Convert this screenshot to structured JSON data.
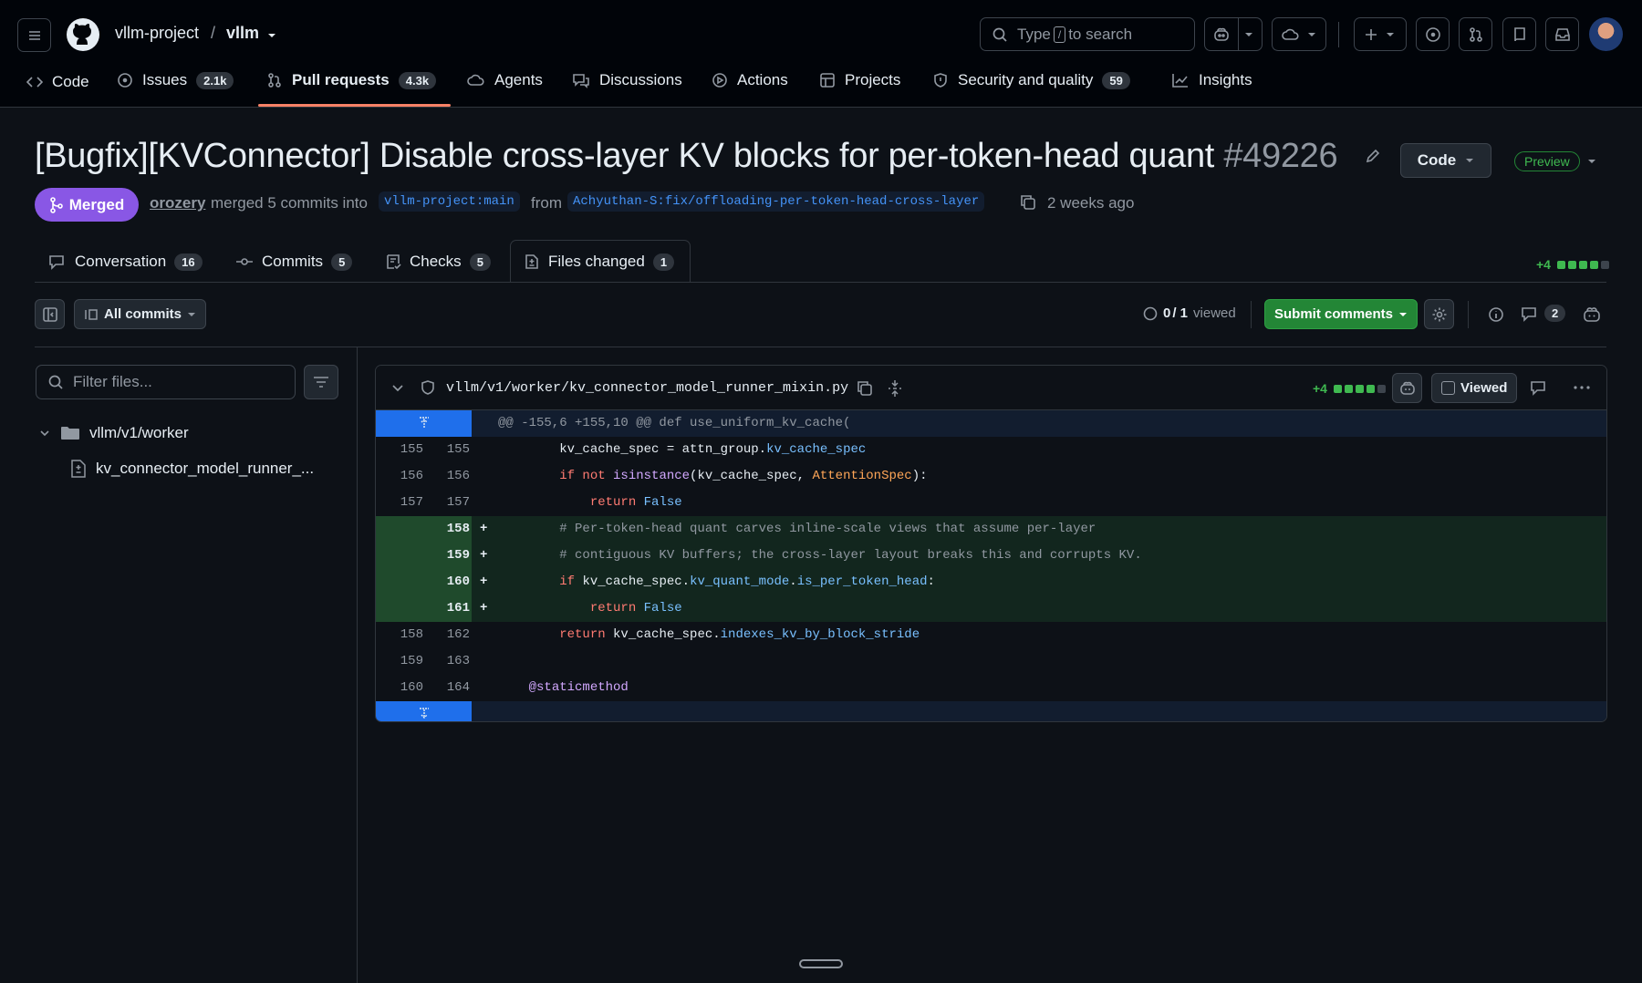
{
  "repo": {
    "owner": "vllm-project",
    "separator": "/",
    "name": "vllm"
  },
  "search": {
    "prefix": "Type",
    "key": "/",
    "suffix": "to search"
  },
  "nav": [
    {
      "label": "Code",
      "icon": "code-icon"
    },
    {
      "label": "Issues",
      "count": "2.1k",
      "icon": "issue-icon"
    },
    {
      "label": "Pull requests",
      "count": "4.3k",
      "icon": "pull-request-icon"
    },
    {
      "label": "Agents",
      "icon": "agents-icon"
    },
    {
      "label": "Discussions",
      "icon": "discussion-icon"
    },
    {
      "label": "Actions",
      "icon": "play-icon"
    },
    {
      "label": "Projects",
      "icon": "table-icon"
    },
    {
      "label": "Security and quality",
      "count": "59",
      "icon": "shield-icon"
    },
    {
      "label": "Insights",
      "icon": "graph-icon"
    }
  ],
  "pr": {
    "title": "[Bugfix][KVConnector] Disable cross-layer KV blocks for per-token-head quant",
    "number": "#49226",
    "code_button": "Code",
    "preview_badge": "Preview",
    "state": "Merged",
    "author": "orozery",
    "merged_text": "merged 5 commits into",
    "base_branch": "vllm-project:main",
    "from_text": "from",
    "head_branch": "Achyuthan-S:fix/offloading-per-token-head-cross-layer",
    "time": "2 weeks ago"
  },
  "tabs": [
    {
      "label": "Conversation",
      "count": "16"
    },
    {
      "label": "Commits",
      "count": "5"
    },
    {
      "label": "Checks",
      "count": "5"
    },
    {
      "label": "Files changed",
      "count": "1"
    }
  ],
  "diffstat": {
    "additions": "+4",
    "green_blocks": 4,
    "total_blocks": 5
  },
  "toolbar": {
    "all_commits": "All commits",
    "viewed_count": "0",
    "viewed_total": "/ 1",
    "viewed_label": "viewed",
    "submit": "Submit comments",
    "comments_count": "2"
  },
  "sidebar": {
    "filter_placeholder": "Filter files...",
    "folder": "vllm/v1/worker",
    "file": "kv_connector_model_runner_..."
  },
  "file": {
    "path": "vllm/v1/worker/kv_connector_model_runner_mixin.py",
    "additions": "+4",
    "viewed_label": "Viewed",
    "hunk": "@@ -155,6 +155,10 @@ def use_uniform_kv_cache(",
    "lines": [
      {
        "old": "155",
        "new": "155",
        "type": "ctx",
        "tokens": [
          [
            "t",
            "        kv_cache_spec = attn_group."
          ],
          [
            "prop",
            "kv_cache_spec"
          ]
        ]
      },
      {
        "old": "156",
        "new": "156",
        "type": "ctx",
        "tokens": [
          [
            "t",
            "        "
          ],
          [
            "kw",
            "if not "
          ],
          [
            "fn",
            "isinstance"
          ],
          [
            "t",
            "(kv_cache_spec, "
          ],
          [
            "cls",
            "AttentionSpec"
          ],
          [
            "t",
            "):"
          ]
        ]
      },
      {
        "old": "157",
        "new": "157",
        "type": "ctx",
        "tokens": [
          [
            "t",
            "            "
          ],
          [
            "kw",
            "return "
          ],
          [
            "prop",
            "False"
          ]
        ]
      },
      {
        "old": "",
        "new": "158",
        "type": "add",
        "tokens": [
          [
            "cmt",
            "        # Per-token-head quant carves inline-scale views that assume per-layer"
          ]
        ]
      },
      {
        "old": "",
        "new": "159",
        "type": "add",
        "tokens": [
          [
            "cmt",
            "        # contiguous KV buffers; the cross-layer layout breaks this and corrupts KV."
          ]
        ]
      },
      {
        "old": "",
        "new": "160",
        "type": "add",
        "tokens": [
          [
            "t",
            "        "
          ],
          [
            "kw",
            "if "
          ],
          [
            "t",
            "kv_cache_spec."
          ],
          [
            "prop",
            "kv_quant_mode"
          ],
          [
            "t",
            "."
          ],
          [
            "prop",
            "is_per_token_head"
          ],
          [
            "t",
            ":"
          ]
        ]
      },
      {
        "old": "",
        "new": "161",
        "type": "add",
        "tokens": [
          [
            "t",
            "            "
          ],
          [
            "kw",
            "return "
          ],
          [
            "prop",
            "False"
          ]
        ]
      },
      {
        "old": "158",
        "new": "162",
        "type": "ctx",
        "tokens": [
          [
            "t",
            "        "
          ],
          [
            "kw",
            "return "
          ],
          [
            "t",
            "kv_cache_spec."
          ],
          [
            "prop",
            "indexes_kv_by_block_stride"
          ]
        ]
      },
      {
        "old": "159",
        "new": "163",
        "type": "ctx",
        "tokens": [
          [
            "t",
            ""
          ]
        ]
      },
      {
        "old": "160",
        "new": "164",
        "type": "ctx",
        "tokens": [
          [
            "t",
            "    "
          ],
          [
            "dec",
            "@staticmethod"
          ]
        ]
      }
    ]
  },
  "colors": {
    "accent": "#f78166",
    "merged": "#8957e5",
    "add_bg": "#12261e",
    "add_gutter": "#1f4a2c",
    "hunk_bg": "#121d2f",
    "expander": "#1f6feb"
  }
}
